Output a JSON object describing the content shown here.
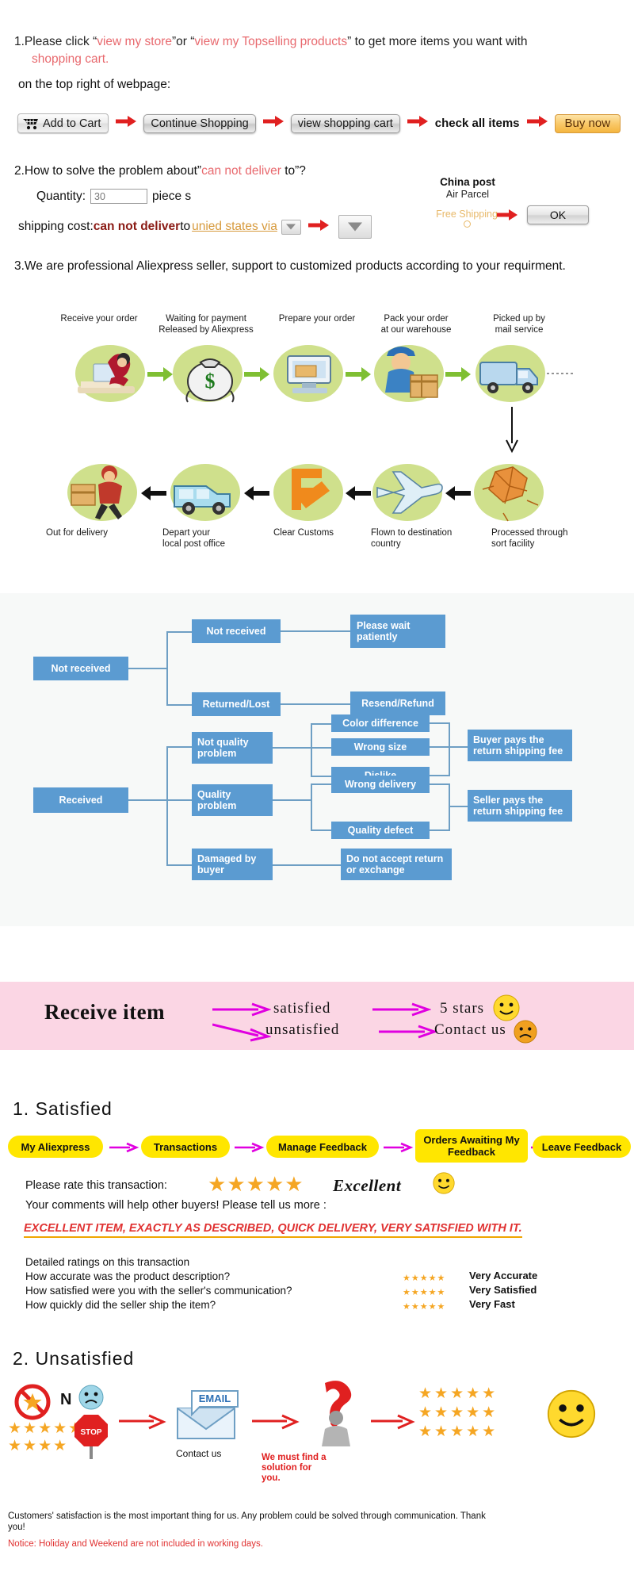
{
  "section1": {
    "line1_a": "1.Please click “",
    "line1_link1": "view my store",
    "line1_b": "”or “",
    "line1_link2": "view my Topselling products",
    "line1_c": "” to get more items you want with",
    "line2": "shopping cart.",
    "line3": "on the top right of webpage:",
    "buttons": {
      "add_to_cart": "Add to Cart",
      "continue_shopping": "Continue Shopping",
      "view_shopping_cart": "view shopping cart",
      "check_all_items": "check all items",
      "buy_now": "Buy now"
    }
  },
  "section2": {
    "heading_a": "2.How to solve the problem about”",
    "heading_red": "can not deliver",
    "heading_b": " to”?",
    "quantity_label": "Quantity:",
    "quantity_value": "30",
    "quantity_unit": "piece s",
    "shipping_label": "shipping cost:",
    "shipping_status": "can not deliver",
    "shipping_to": " to ",
    "shipping_country": "unied states via",
    "carrier_name": "China post",
    "carrier_service": "Air Parcel",
    "free_shipping": "Free Shipping",
    "ok_button": "OK"
  },
  "section3": {
    "text": "3.We are professional Aliexpress seller, support to customized products according to your requirment."
  },
  "delivery_flow": {
    "row1": [
      "Receive your order",
      "Waiting for payment\nReleased by Aliexpress",
      "Prepare your order",
      "Pack your order\nat our warehouse",
      "Picked up by\nmail service"
    ],
    "row2": [
      "Out for delivery",
      "Depart your\nlocal post office",
      "Clear Customs",
      "Flown to destination\ncountry",
      "Processed through\nsort facility"
    ]
  },
  "flowchart": {
    "accent": "#5b9bd1",
    "background": "#f7f9f8",
    "not_received_root": "Not received",
    "not_received_child1": "Not received",
    "not_received_child2": "Returned/Lost",
    "not_received_result1": "Please wait patiently",
    "not_received_result2": "Resend/Refund",
    "received_root": "Received",
    "branch_not_quality": "Not quality problem",
    "branch_quality": "Quality problem",
    "branch_damaged": "Damaged by buyer",
    "nq1": "Color difference",
    "nq2": "Wrong size",
    "nq3": "Dislike",
    "q1": "Wrong delivery",
    "q2": "Quality defect",
    "buyer_pays": "Buyer pays the return shipping fee",
    "seller_pays": "Seller pays the return shipping fee",
    "damaged_result": "Do not accept return or exchange"
  },
  "receive_band": {
    "background": "#fbd6e4",
    "title": "Receive item",
    "branch1": "satisfied",
    "branch2": "unsatisfied",
    "result1": "5 stars",
    "result2": "Contact us"
  },
  "satisfied": {
    "heading": "1. Satisfied",
    "steps": [
      "My Aliexpress",
      "Transactions",
      "Manage Feedback",
      "Orders Awaiting My Feedback",
      "Leave Feedback"
    ],
    "rate_prompt": "Please rate this transaction:",
    "rating_stars": 5,
    "rating_word": "Excellent",
    "comment_prompt": "Your comments will help other buyers! Please tell us more :",
    "comment_text": "EXCELLENT ITEM, EXACTLY AS DESCRIBED, QUICK DELIVERY, VERY SATISFIED WITH IT.",
    "detailed_title": "Detailed ratings on this transaction",
    "detailed": [
      {
        "question": "How accurate was the product description?",
        "stars": 5,
        "label": "Very Accurate"
      },
      {
        "question": "How satisfied were you with the seller's communication?",
        "stars": 5,
        "label": "Very Satisfied"
      },
      {
        "question": "How quickly did the seller ship the item?",
        "stars": 5,
        "label": "Very Fast"
      }
    ]
  },
  "unsatisfied": {
    "heading": "2. Unsatisfied",
    "no_label": "N",
    "stop_label": "STOP",
    "contact_label": "Contact us",
    "solution_label": "We must find a solution for you.",
    "footer_note": "Customers' satisfaction is the most important thing for us. Any problem could be solved through communication. Thank you!",
    "footer_notice": "Notice: Holiday and Weekend are not included in working days."
  }
}
